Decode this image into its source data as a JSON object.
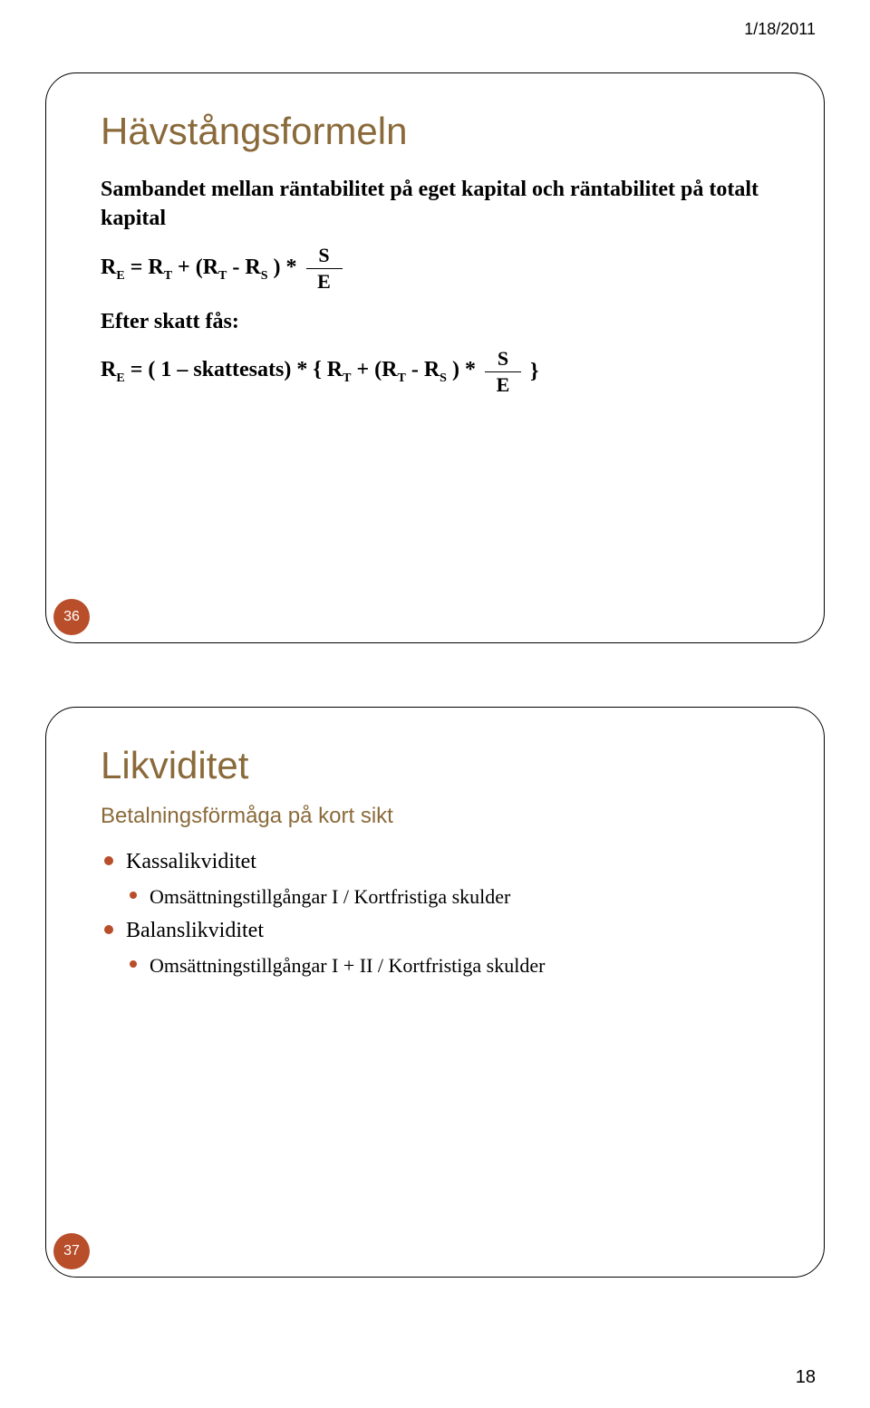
{
  "header": {
    "date": "1/18/2011"
  },
  "footer": {
    "page_number": "18"
  },
  "slide1": {
    "title": "Hävstångsformeln",
    "intro": "Sambandet mellan räntabilitet på eget kapital och räntabilitet på totalt kapital",
    "formula1_lhs": "R",
    "formula1_lhs_sub": "E",
    "formula1_eq": " = R",
    "formula1_rt_sub": "T",
    "formula1_plus": " + (R",
    "formula1_rt2_sub": "T",
    "formula1_minus": " - R",
    "formula1_rs_sub": "S",
    "formula1_close": " )  *",
    "frac1_num": "S",
    "frac1_den": "E",
    "line_after": "Efter skatt fås:",
    "formula2_lhs": "R",
    "formula2_lhs_sub": "E",
    "formula2_eq": " = ( 1 – skattesats) * { R",
    "formula2_rt_sub": "T",
    "formula2_plus": " + (R",
    "formula2_rt2_sub": "T",
    "formula2_minus": " - R",
    "formula2_rs_sub": "S",
    "formula2_close": " ) *",
    "frac2_num": "S",
    "frac2_den": "E",
    "formula2_brace_close": "}",
    "badge": "36"
  },
  "slide2": {
    "title": "Likviditet",
    "subtitle": "Betalningsförmåga på kort sikt",
    "bullets": [
      {
        "label": "Kassalikviditet",
        "sub": "Omsättningstillgångar I / Kortfristiga skulder"
      },
      {
        "label": "Balanslikviditet",
        "sub": "Omsättningstillgångar I + II / Kortfristiga skulder"
      }
    ],
    "badge": "37"
  }
}
